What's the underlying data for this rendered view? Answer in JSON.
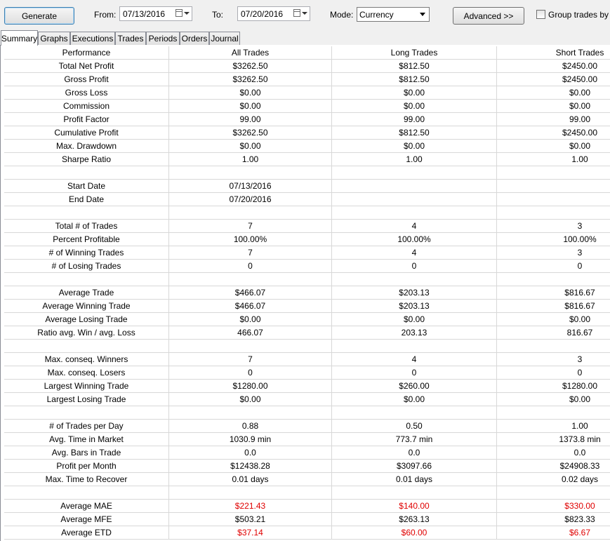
{
  "toolbar": {
    "generate_label": "Generate",
    "from_label": "From:",
    "from_value": "07/13/2016",
    "to_label": "To:",
    "to_value": "07/20/2016",
    "mode_label": "Mode:",
    "mode_value": "Currency",
    "advanced_label": "Advanced >>",
    "group_trades_label": "Group trades by A"
  },
  "tabs": [
    "Summary",
    "Graphs",
    "Executions",
    "Trades",
    "Periods",
    "Orders",
    "Journal"
  ],
  "active_tab": "Summary",
  "table": {
    "headers": [
      "Performance",
      "All Trades",
      "Long Trades",
      "Short Trades"
    ],
    "rows": [
      [
        "Total Net Profit",
        "$3262.50",
        "$812.50",
        "$2450.00"
      ],
      [
        "Gross Profit",
        "$3262.50",
        "$812.50",
        "$2450.00"
      ],
      [
        "Gross Loss",
        "$0.00",
        "$0.00",
        "$0.00"
      ],
      [
        "Commission",
        "$0.00",
        "$0.00",
        "$0.00"
      ],
      [
        "Profit Factor",
        "99.00",
        "99.00",
        "99.00"
      ],
      [
        "Cumulative Profit",
        "$3262.50",
        "$812.50",
        "$2450.00"
      ],
      [
        "Max. Drawdown",
        "$0.00",
        "$0.00",
        "$0.00"
      ],
      [
        "Sharpe Ratio",
        "1.00",
        "1.00",
        "1.00"
      ],
      [
        "",
        "",
        "",
        ""
      ],
      [
        "Start Date",
        "07/13/2016",
        "",
        ""
      ],
      [
        "End Date",
        "07/20/2016",
        "",
        ""
      ],
      [
        "",
        "",
        "",
        ""
      ],
      [
        "Total # of Trades",
        "7",
        "4",
        "3"
      ],
      [
        "Percent Profitable",
        "100.00%",
        "100.00%",
        "100.00%"
      ],
      [
        "# of Winning Trades",
        "7",
        "4",
        "3"
      ],
      [
        "# of Losing Trades",
        "0",
        "0",
        "0"
      ],
      [
        "",
        "",
        "",
        ""
      ],
      [
        "Average Trade",
        "$466.07",
        "$203.13",
        "$816.67"
      ],
      [
        "Average Winning Trade",
        "$466.07",
        "$203.13",
        "$816.67"
      ],
      [
        "Average Losing Trade",
        "$0.00",
        "$0.00",
        "$0.00"
      ],
      [
        "Ratio avg. Win / avg. Loss",
        "466.07",
        "203.13",
        "816.67"
      ],
      [
        "",
        "",
        "",
        ""
      ],
      [
        "Max. conseq. Winners",
        "7",
        "4",
        "3"
      ],
      [
        "Max. conseq. Losers",
        "0",
        "0",
        "0"
      ],
      [
        "Largest Winning Trade",
        "$1280.00",
        "$260.00",
        "$1280.00"
      ],
      [
        "Largest Losing Trade",
        "$0.00",
        "$0.00",
        "$0.00"
      ],
      [
        "",
        "",
        "",
        ""
      ],
      [
        "# of Trades per Day",
        "0.88",
        "0.50",
        "1.00"
      ],
      [
        "Avg. Time in Market",
        "1030.9 min",
        "773.7 min",
        "1373.8 min"
      ],
      [
        "Avg. Bars in Trade",
        "0.0",
        "0.0",
        "0.0"
      ],
      [
        "Profit per Month",
        "$12438.28",
        "$3097.66",
        "$24908.33"
      ],
      [
        "Max. Time to Recover",
        "0.01 days",
        "0.01 days",
        "0.02 days"
      ],
      [
        "",
        "",
        "",
        ""
      ],
      [
        "Average MAE",
        "$221.43",
        "$140.00",
        "$330.00"
      ],
      [
        "Average MFE",
        "$503.21",
        "$263.13",
        "$823.33"
      ],
      [
        "Average ETD",
        "$37.14",
        "$60.00",
        "$6.67"
      ]
    ],
    "red_row_labels": [
      "Average MAE",
      "Average ETD"
    ],
    "negative_value_color": "#e00000"
  }
}
